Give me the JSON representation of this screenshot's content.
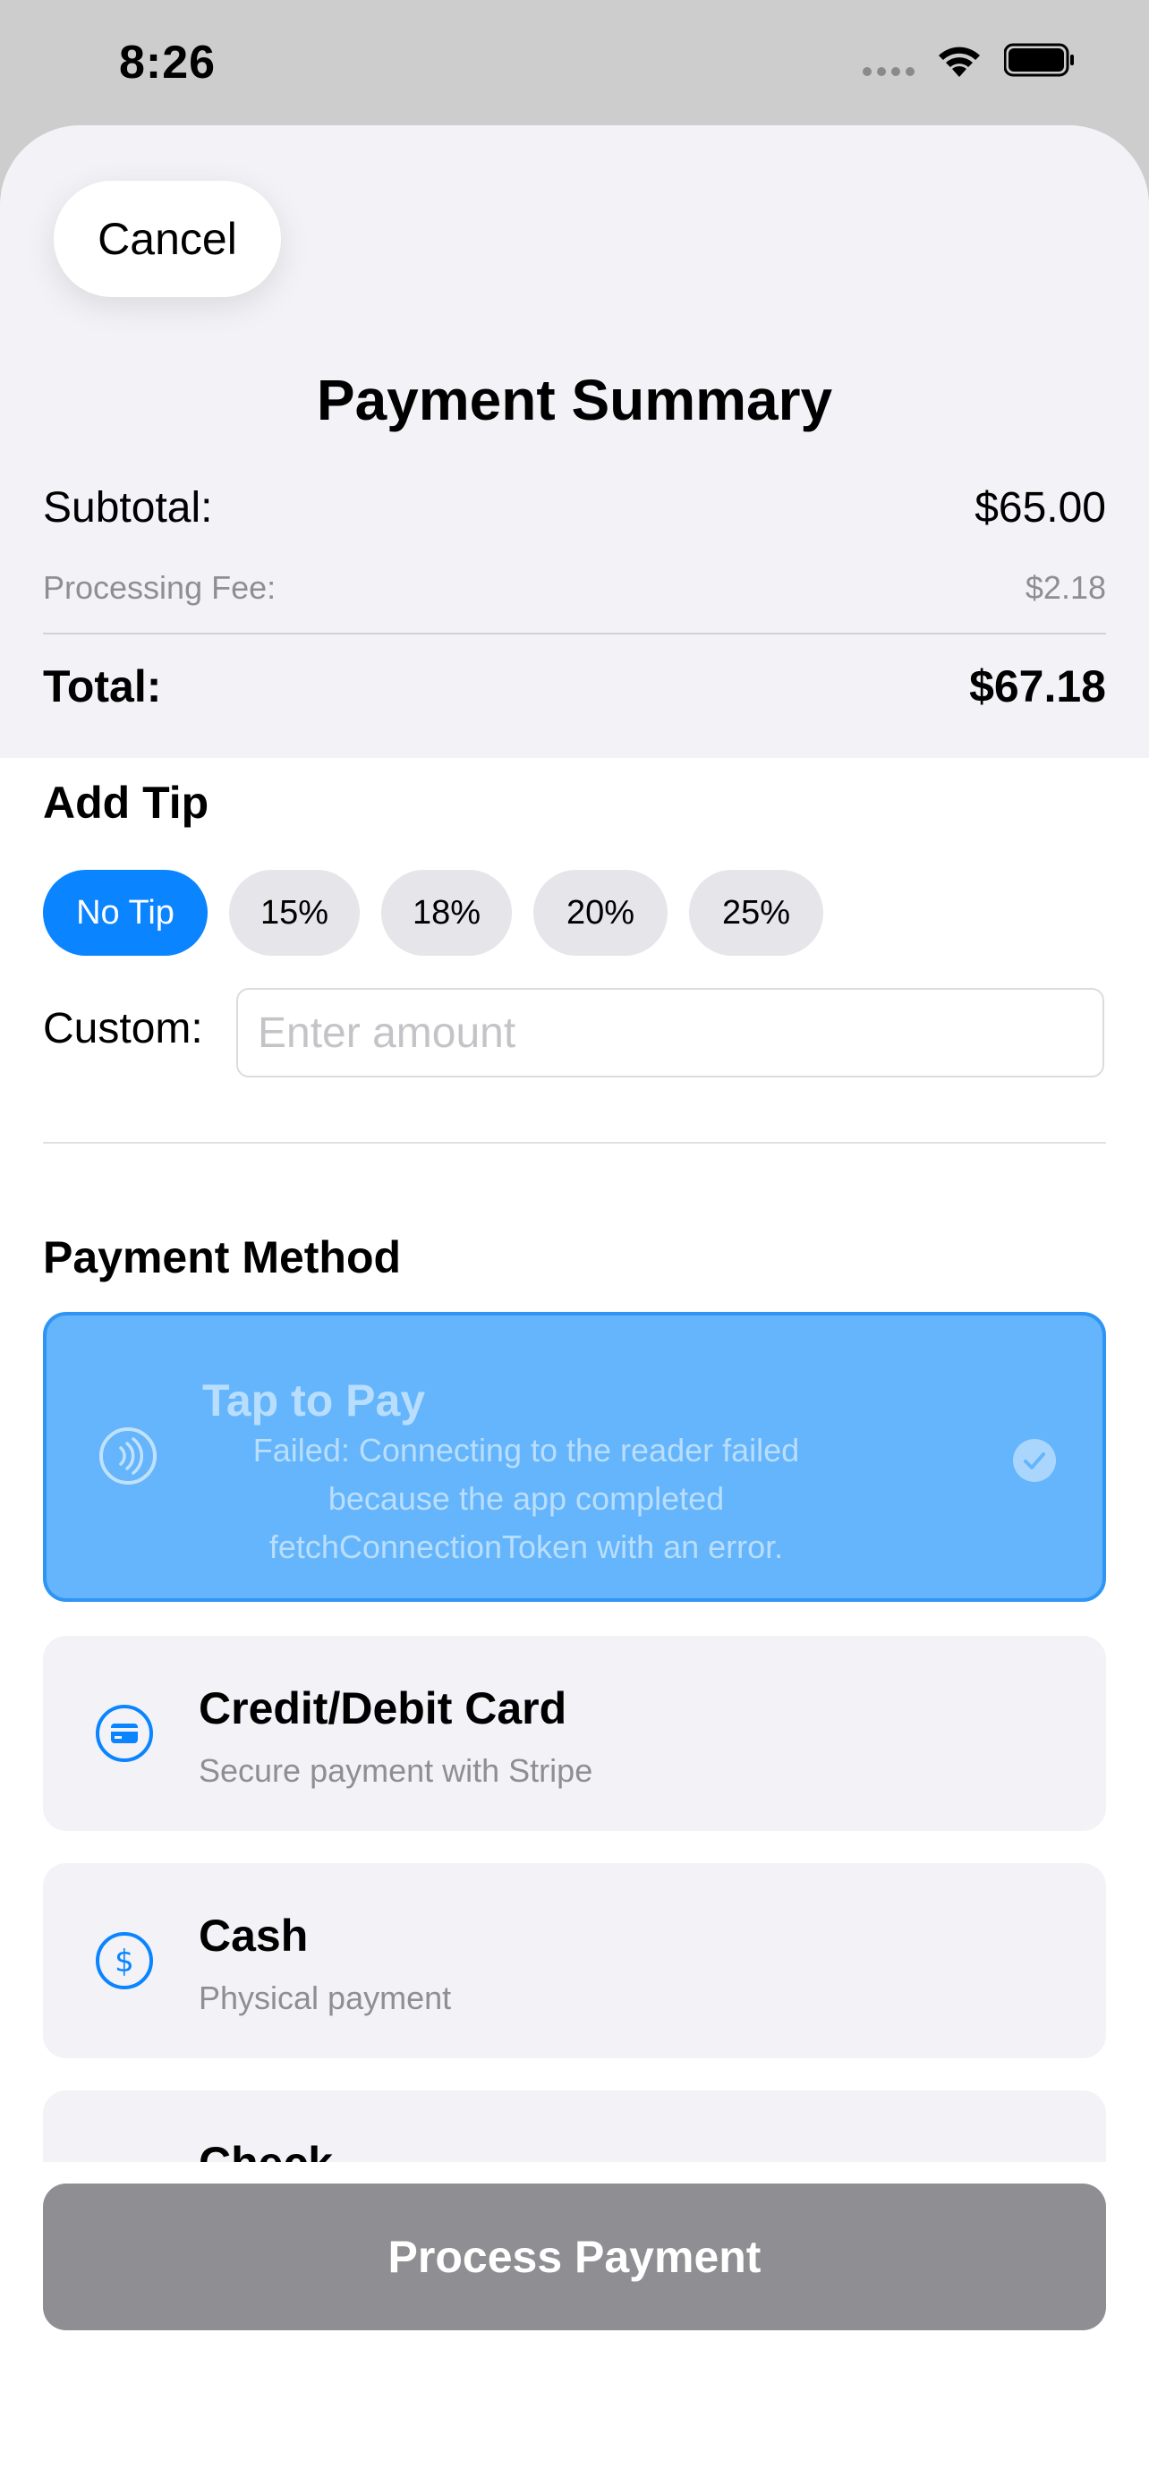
{
  "status_bar": {
    "time": "8:26"
  },
  "header": {
    "cancel_label": "Cancel",
    "title": "Payment Summary"
  },
  "summary": {
    "subtotal_label": "Subtotal:",
    "subtotal_value": "$65.00",
    "fee_label": "Processing Fee:",
    "fee_value": "$2.18",
    "total_label": "Total:",
    "total_value": "$67.18"
  },
  "tip": {
    "title": "Add Tip",
    "options": [
      {
        "label": "No Tip",
        "selected": true
      },
      {
        "label": "15%",
        "selected": false
      },
      {
        "label": "18%",
        "selected": false
      },
      {
        "label": "20%",
        "selected": false
      },
      {
        "label": "25%",
        "selected": false
      }
    ],
    "custom_label": "Custom:",
    "custom_placeholder": "Enter amount",
    "custom_value": ""
  },
  "payment_method": {
    "title": "Payment Method",
    "methods": [
      {
        "title": "Tap to Pay",
        "subtitle": "Failed: Connecting to the reader failed because the app completed fetchConnectionToken with an error.",
        "icon": "contactless-icon",
        "selected": true
      },
      {
        "title": "Credit/Debit Card",
        "subtitle": "Secure payment with Stripe",
        "icon": "credit-card-icon",
        "selected": false
      },
      {
        "title": "Cash",
        "subtitle": "Physical payment",
        "icon": "dollar-icon",
        "selected": false
      },
      {
        "title": "Check",
        "subtitle": "",
        "icon": "check-icon",
        "selected": false
      }
    ]
  },
  "footer": {
    "process_label": "Process Payment"
  },
  "colors": {
    "accent": "#0a84ff",
    "selected_card": "#64b5fb",
    "disabled_button": "#8e8e93"
  }
}
